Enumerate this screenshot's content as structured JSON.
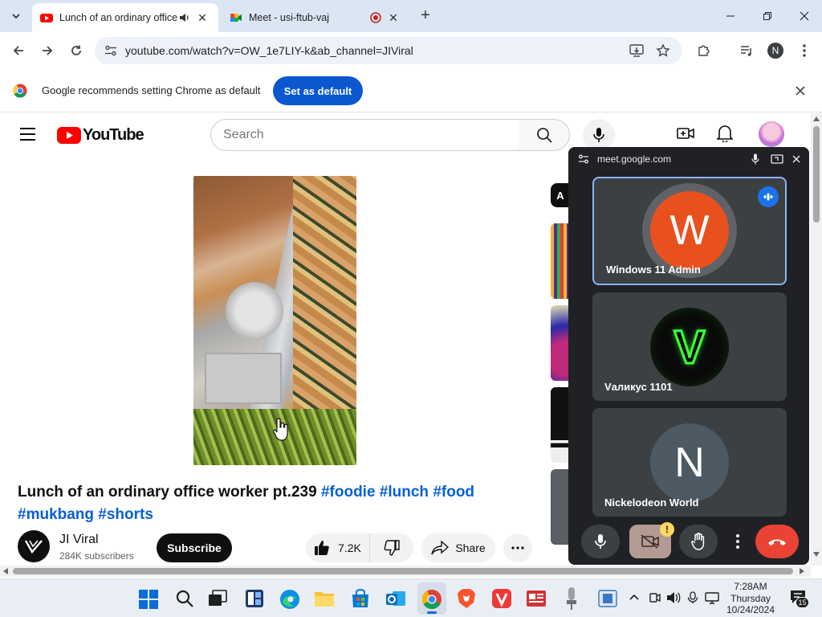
{
  "browser": {
    "tabs": [
      {
        "title": "Lunch of an ordinary office",
        "active": true,
        "favicon": "youtube-icon"
      },
      {
        "title": "Meet - usi-ftub-vaj",
        "active": false,
        "favicon": "google-meet-icon"
      }
    ],
    "url": "youtube.com/watch?v=OW_1e7LIY-k&ab_channel=JIViral",
    "profile_initial": "N"
  },
  "infobar": {
    "message": "Google recommends setting Chrome as default",
    "button": "Set as default"
  },
  "youtube": {
    "logo_text": "YouTube",
    "search_placeholder": "Search",
    "video": {
      "title_main": "Lunch of an ordinary office worker pt.239",
      "hashtags_line1": "#foodie #lunch #food",
      "hashtags_line2": "#mukbang #shorts"
    },
    "channel": {
      "name": "JI Viral",
      "subscribers": "284K subscribers"
    },
    "subscribe_label": "Subscribe",
    "likes": "7.2K",
    "share_label": "Share",
    "chip_partial": "A"
  },
  "meet": {
    "host": "meet.google.com",
    "participants": [
      {
        "name": "Windows 11 Admin",
        "initial": "W",
        "color": "#e8511e",
        "speaking": true
      },
      {
        "name": "Vаликус 1101",
        "initial": "V",
        "color": "#0a0a0a",
        "speaking": false
      },
      {
        "name": "Nickelodeon World",
        "initial": "N",
        "color": "#4d5a63",
        "speaking": false
      }
    ],
    "camera_warning": "!"
  },
  "taskbar": {
    "time": "7:28AM",
    "day": "Thursday",
    "date": "10/24/2024",
    "notification_count": "15"
  },
  "colors": {
    "youtube_red": "#ff0000",
    "chrome_blue": "#0b57d0",
    "meet_dark": "#202124",
    "end_call_red": "#ea4335"
  }
}
